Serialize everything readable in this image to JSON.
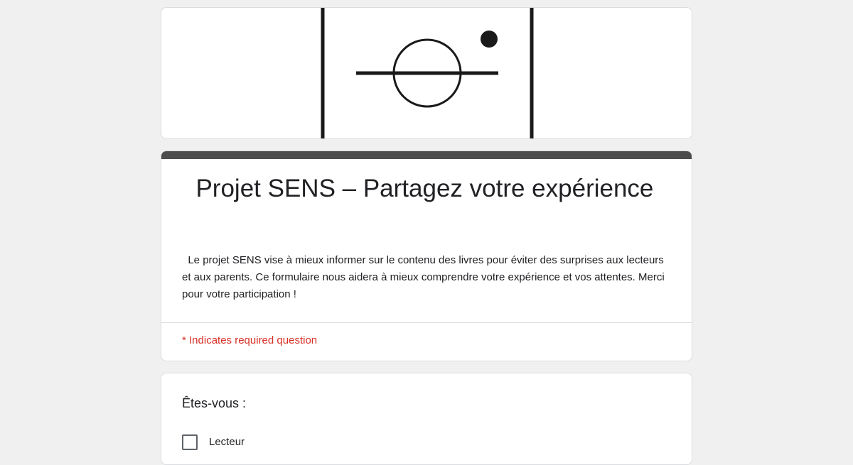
{
  "form": {
    "header_logo": "sens-logo-icon",
    "title": "  Projet SENS – Partagez votre expérience",
    "description": "  Le projet SENS vise à mieux informer sur le contenu des livres pour éviter des surprises aux lecteurs et aux parents. Ce formulaire nous aidera à mieux comprendre votre expérience et vos attentes. Merci pour votre participation !",
    "required_note": "* Indicates required question",
    "accent_color": "#4d4d4d",
    "required_color": "#d93025"
  },
  "question1": {
    "title": "Êtes-vous :",
    "options": [
      {
        "label": "Lecteur",
        "checked": false
      }
    ]
  }
}
